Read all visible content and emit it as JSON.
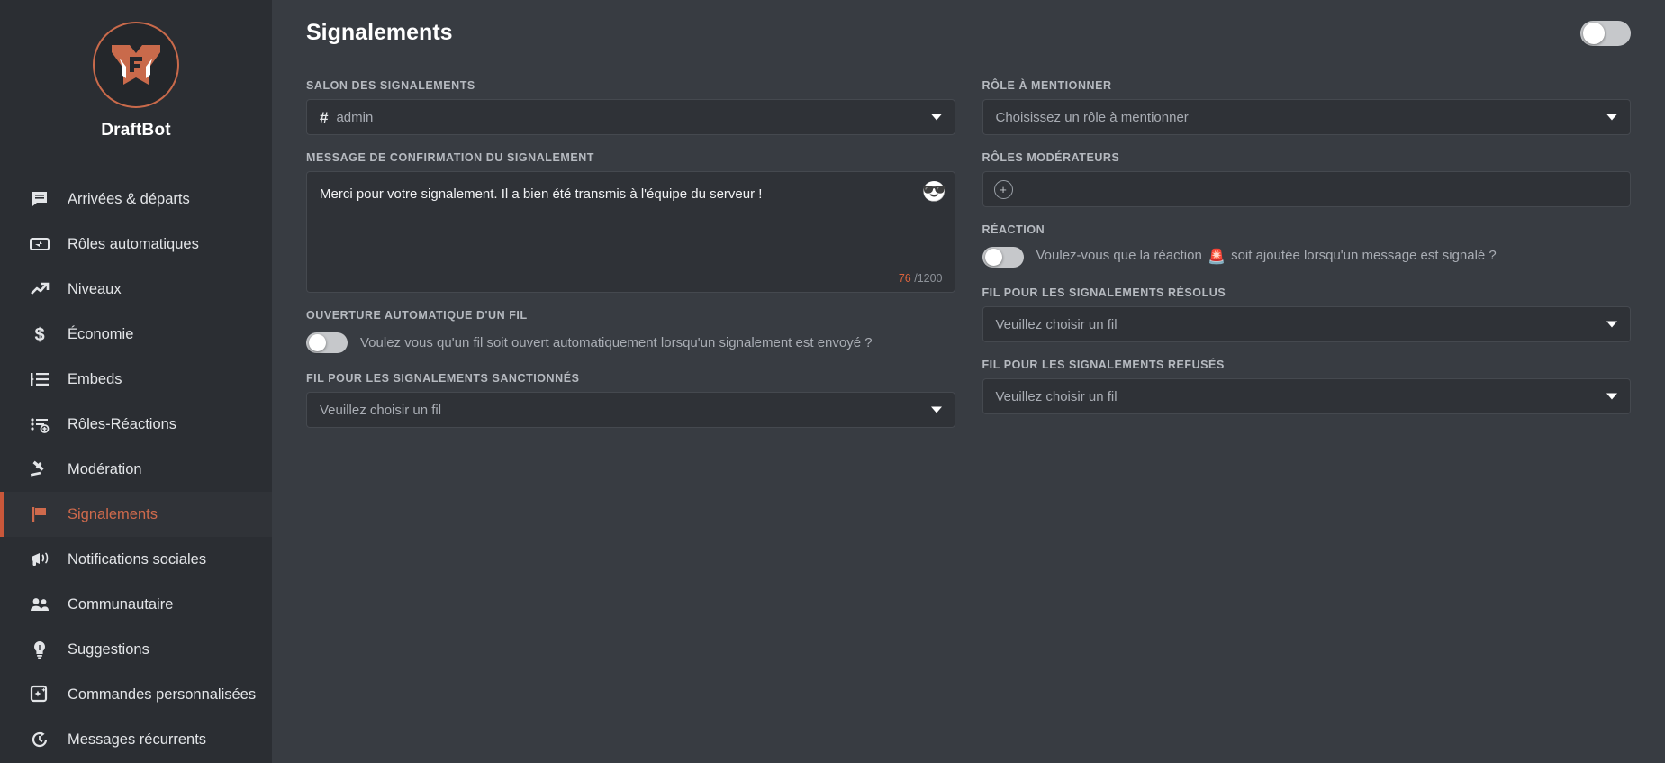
{
  "brand": {
    "name": "DraftBot",
    "logo_icon": "draftbot-logo-icon",
    "accent": "#c9573a"
  },
  "sidebar": {
    "items": [
      {
        "label": "Arrivées & départs",
        "icon": "message-square-icon",
        "active": false
      },
      {
        "label": "Rôles automatiques",
        "icon": "auto-role-icon",
        "active": false
      },
      {
        "label": "Niveaux",
        "icon": "trending-up-icon",
        "active": false
      },
      {
        "label": "Économie",
        "icon": "dollar-sign-icon",
        "active": false
      },
      {
        "label": "Embeds",
        "icon": "embed-list-icon",
        "active": false
      },
      {
        "label": "Rôles-Réactions",
        "icon": "list-plus-icon",
        "active": false
      },
      {
        "label": "Modération",
        "icon": "gavel-icon",
        "active": false
      },
      {
        "label": "Signalements",
        "icon": "flag-icon",
        "active": true
      },
      {
        "label": "Notifications sociales",
        "icon": "megaphone-icon",
        "active": false
      },
      {
        "label": "Communautaire",
        "icon": "users-icon",
        "active": false
      },
      {
        "label": "Suggestions",
        "icon": "lightbulb-icon",
        "active": false
      },
      {
        "label": "Commandes personnalisées",
        "icon": "custom-command-icon",
        "active": false
      },
      {
        "label": "Messages récurrents",
        "icon": "refresh-clock-icon",
        "active": false
      }
    ]
  },
  "header": {
    "title": "Signalements",
    "module_toggle": {
      "name": "module-enable-toggle",
      "state": "off"
    }
  },
  "form": {
    "report_channel": {
      "label": "SALON DES SIGNALEMENTS",
      "value": "admin",
      "prefix_icon": "hash-icon",
      "caret_icon": "chevron-down-icon"
    },
    "mention_role": {
      "label": "RÔLE À MENTIONNER",
      "placeholder": "Choisissez un rôle à mentionner",
      "value": "",
      "caret_icon": "chevron-down-icon"
    },
    "confirmation_message": {
      "label": "MESSAGE DE CONFIRMATION DU SIGNALEMENT",
      "value": "Merci pour votre signalement. Il a bien été transmis à l'équipe du serveur !",
      "emoji_button_icon": "emoji-picker-icon",
      "emoji_button_glyph": "😎",
      "chars_used": "76",
      "chars_max": "/1200"
    },
    "moderator_roles": {
      "label": "RÔLES MODÉRATEURS",
      "add_label": "+",
      "add_icon": "plus-circle-icon"
    },
    "reaction": {
      "label": "RÉACTION",
      "toggle_state": "off",
      "text_before": "Voulez-vous que la réaction",
      "emoji": "🚨",
      "emoji_icon": "police-light-emoji",
      "text_after": "soit ajoutée lorsqu'un message est signalé ?"
    },
    "auto_thread": {
      "label": "OUVERTURE AUTOMATIQUE D'UN FIL",
      "toggle_state": "off",
      "text": "Voulez vous qu'un fil soit ouvert automatiquement lorsqu'un signalement est envoyé ?"
    },
    "thread_resolved": {
      "label": "FIL POUR LES SIGNALEMENTS RÉSOLUS",
      "placeholder": "Veuillez choisir un fil",
      "caret_icon": "chevron-down-icon"
    },
    "thread_sanctioned": {
      "label": "FIL POUR LES SIGNALEMENTS SANCTIONNÉS",
      "placeholder": "Veuillez choisir un fil",
      "caret_icon": "chevron-down-icon"
    },
    "thread_refused": {
      "label": "FIL POUR LES SIGNALEMENTS REFUSÉS",
      "placeholder": "Veuillez choisir un fil",
      "caret_icon": "chevron-down-icon"
    }
  }
}
